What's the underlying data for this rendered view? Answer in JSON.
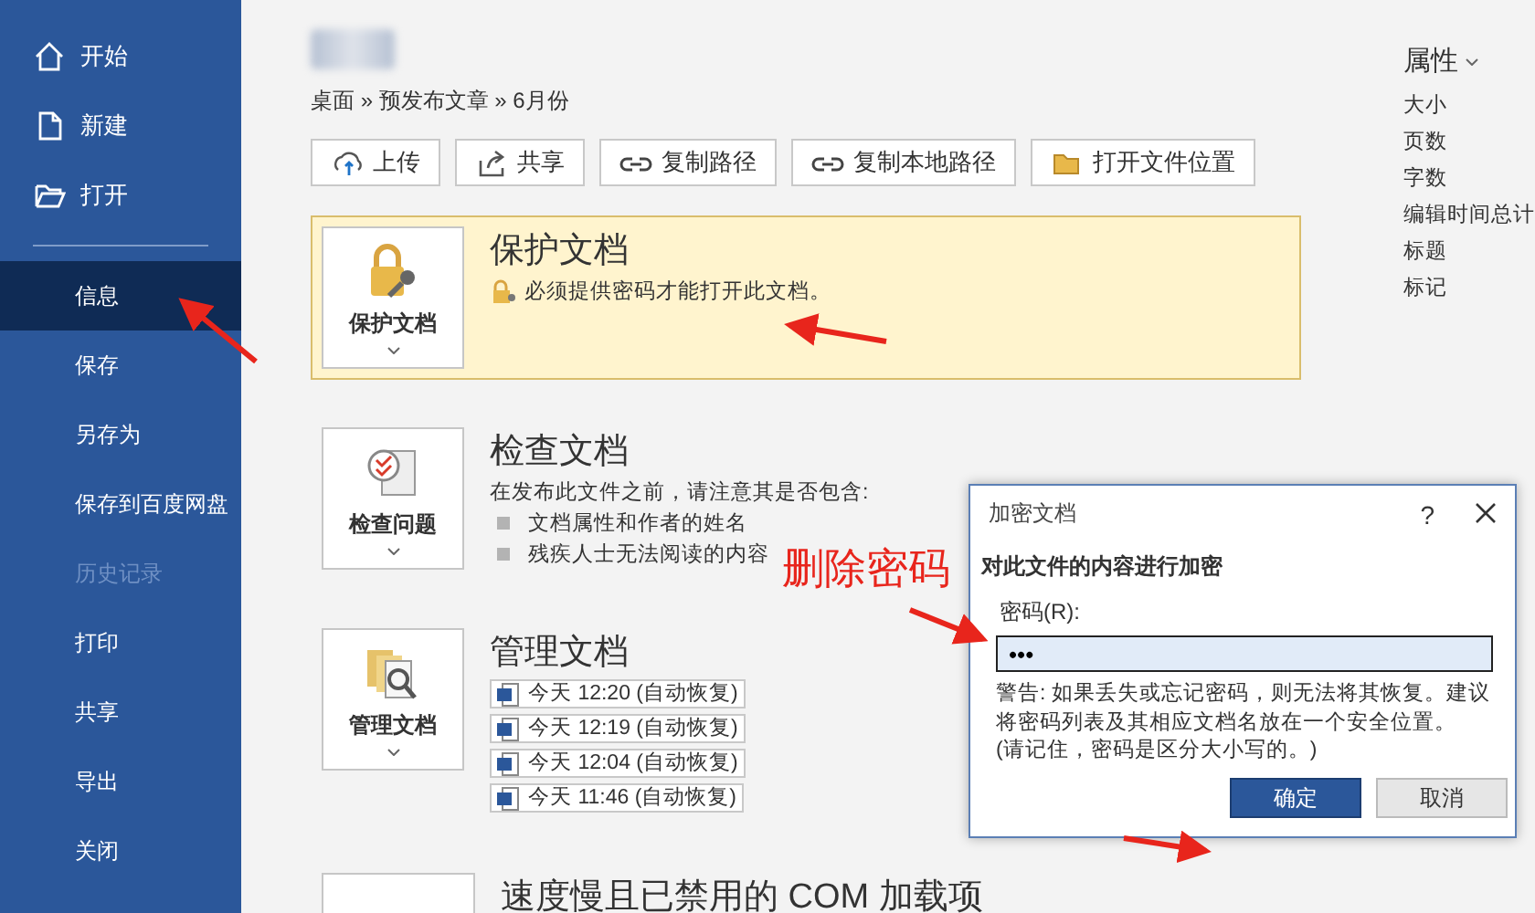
{
  "sidebar": {
    "top_items": [
      "开始",
      "新建",
      "打开"
    ],
    "items": [
      {
        "label": "信息",
        "selected": true,
        "disabled": false
      },
      {
        "label": "保存",
        "selected": false,
        "disabled": false
      },
      {
        "label": "另存为",
        "selected": false,
        "disabled": false
      },
      {
        "label": "保存到百度网盘",
        "selected": false,
        "disabled": false
      },
      {
        "label": "历史记录",
        "selected": false,
        "disabled": true
      },
      {
        "label": "打印",
        "selected": false,
        "disabled": false
      },
      {
        "label": "共享",
        "selected": false,
        "disabled": false
      },
      {
        "label": "导出",
        "selected": false,
        "disabled": false
      },
      {
        "label": "关闭",
        "selected": false,
        "disabled": false
      }
    ]
  },
  "breadcrumb": "桌面 » 预发布文章 » 6月份",
  "toolbar": [
    "上传",
    "共享",
    "复制路径",
    "复制本地路径",
    "打开文件位置"
  ],
  "sections": [
    {
      "kind": "protect",
      "tile_label": "保护文档",
      "title": "保护文档",
      "highlighted": true,
      "description": "必须提供密码才能打开此文档。"
    },
    {
      "kind": "inspect",
      "tile_label": "检查问题",
      "title": "检查文档",
      "highlighted": false,
      "description": "在发布此文件之前，请注意其是否包含:",
      "bullets": [
        "文档属性和作者的姓名",
        "残疾人士无法阅读的内容"
      ]
    },
    {
      "kind": "manage",
      "tile_label": "管理文档",
      "title": "管理文档",
      "highlighted": false,
      "versions": [
        "今天 12:20 (自动恢复)",
        "今天 12:19 (自动恢复)",
        "今天 12:04 (自动恢复)",
        "今天 11:46 (自动恢复)"
      ]
    },
    {
      "kind": "com",
      "title": "速度慢且已禁用的 COM 加载项",
      "highlighted": false
    }
  ],
  "properties": {
    "title": "属性",
    "items": [
      "大小",
      "页数",
      "字数",
      "编辑时间总计",
      "标题",
      "标记"
    ]
  },
  "dialog": {
    "title": "加密文档",
    "help": "?",
    "heading": "对此文件的内容进行加密",
    "field_label": "密码(R):",
    "value": "•••",
    "warning": "警告: 如果丢失或忘记密码，则无法将其恢复。建议将密码列表及其相应文档名放在一个安全位置。\n(请记住，密码是区分大小写的。)",
    "buttons": [
      {
        "label": "确定",
        "selected": true
      },
      {
        "label": "取消",
        "selected": false
      }
    ]
  },
  "annotation": "删除密码"
}
